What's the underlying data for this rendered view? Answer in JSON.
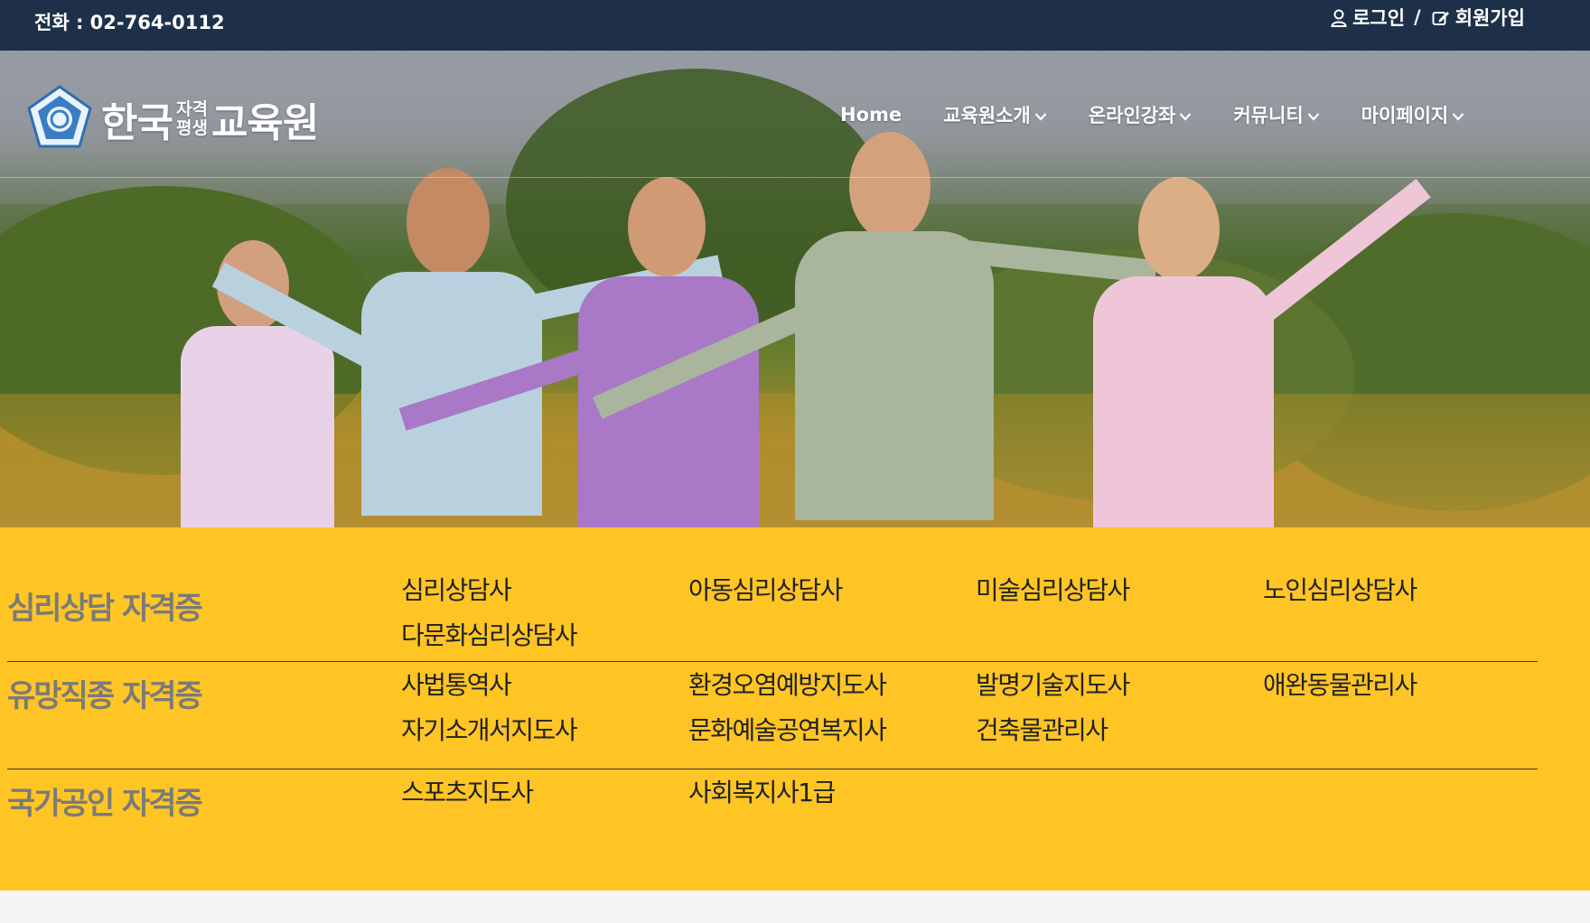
{
  "topbar": {
    "phone": "전화 : 02-764-0112",
    "login_label": "로그인",
    "separator": "/",
    "signup_label": "회원가입"
  },
  "logo": {
    "title_main": "한국",
    "title_small_1": "자격",
    "title_small_2": "평생",
    "title_end": "교육원"
  },
  "nav": {
    "items": [
      {
        "label": "Home",
        "has_dropdown": false
      },
      {
        "label": "교육원소개",
        "has_dropdown": true
      },
      {
        "label": "온라인강좌",
        "has_dropdown": true
      },
      {
        "label": "커뮤니티",
        "has_dropdown": true
      },
      {
        "label": "마이페이지",
        "has_dropdown": true
      }
    ]
  },
  "categories": [
    {
      "title": "심리상담 자격증",
      "items": [
        "심리상담사",
        "아동심리상담사",
        "미술심리상담사",
        "노인심리상담사",
        "다문화심리상담사"
      ]
    },
    {
      "title": "유망직종 자격증",
      "items": [
        "사법통역사",
        "환경오염예방지도사",
        "발명기술지도사",
        "애완동물관리사",
        "자기소개서지도사",
        "문화예술공연복지사",
        "건축물관리사"
      ]
    },
    {
      "title": "국가공인 자격증",
      "items": [
        "스포츠지도사",
        "사회복지사1급"
      ]
    }
  ],
  "colors": {
    "topbar_bg": "#1e3049",
    "panel_bg": "#fec525",
    "category_title": "#7a7a7a",
    "item_text": "#222222"
  },
  "icons": {
    "login": "user-icon",
    "signup": "edit-icon",
    "dropdown": "chevron-down-icon"
  }
}
